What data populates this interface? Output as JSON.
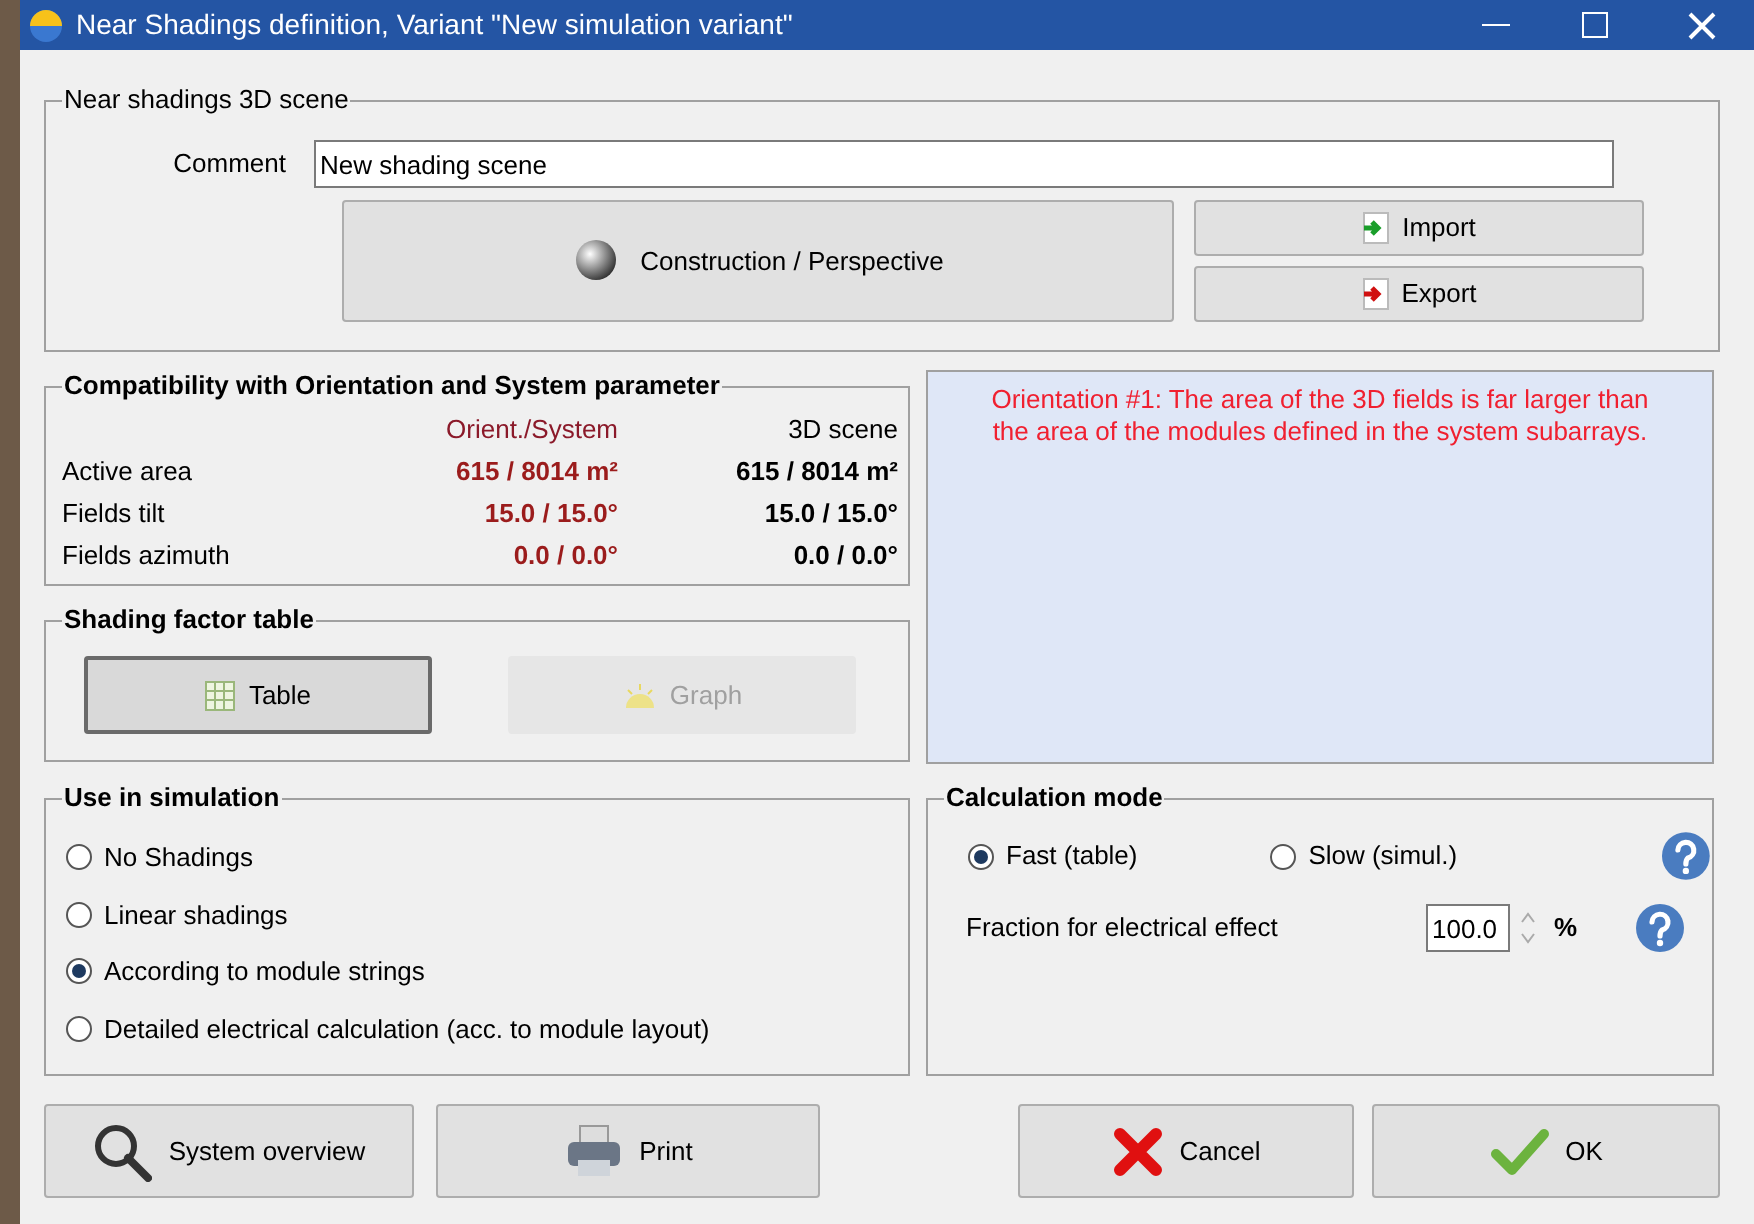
{
  "window": {
    "title": "Near Shadings definition, Variant \"New simulation variant\""
  },
  "scene_group": {
    "title": "Near shadings 3D scene",
    "comment_label": "Comment",
    "comment_value": "New shading scene",
    "construction_button": "Construction / Perspective",
    "import_button": "Import",
    "export_button": "Export"
  },
  "compatibility": {
    "title": "Compatibility with Orientation and System parameter",
    "columns": [
      "Orient./System",
      "3D scene"
    ],
    "rows": [
      {
        "label": "Active area",
        "system": "615 / 8014 m²",
        "scene": "615 / 8014 m²"
      },
      {
        "label": "Fields tilt",
        "system": "15.0 / 15.0°",
        "scene": "15.0 / 15.0°"
      },
      {
        "label": "Fields azimuth",
        "system": "0.0 / 0.0°",
        "scene": "0.0 / 0.0°"
      }
    ]
  },
  "message": "Orientation #1:  The area of the 3D fields is far larger than the area of the modules defined in the system subarrays.",
  "shading_table": {
    "title": "Shading factor table",
    "buttons": [
      {
        "label": "Table",
        "kind": "table",
        "disabled": false
      },
      {
        "label": "Graph",
        "kind": "graph",
        "disabled": true
      }
    ]
  },
  "use_in_simulation": {
    "title": "Use in simulation",
    "options": [
      {
        "label": "No Shadings",
        "selected": false
      },
      {
        "label": "Linear shadings",
        "selected": false
      },
      {
        "label": "According to module strings",
        "selected": true
      },
      {
        "label": "Detailed electrical calculation (acc. to module layout)",
        "selected": false
      }
    ]
  },
  "calculation_mode": {
    "title": "Calculation mode",
    "options": [
      {
        "label": "Fast (table)",
        "selected": true
      },
      {
        "label": "Slow (simul.)",
        "selected": false
      }
    ],
    "fraction_label": "Fraction for electrical effect",
    "fraction_value": "100.0",
    "fraction_unit": "%"
  },
  "buttons": [
    {
      "label": "System overview",
      "kind": "search"
    },
    {
      "label": "Print",
      "kind": "print"
    },
    {
      "label": "Cancel",
      "kind": "cancel"
    },
    {
      "label": "OK",
      "kind": "ok"
    }
  ]
}
